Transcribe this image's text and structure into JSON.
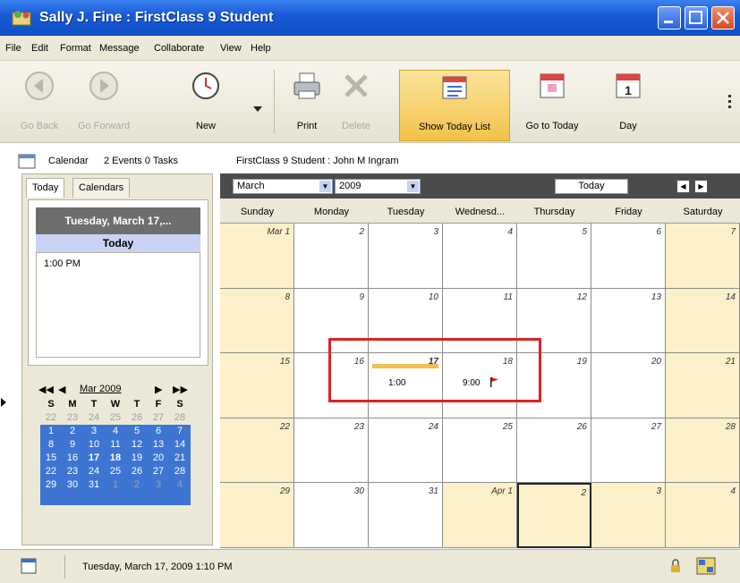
{
  "window": {
    "title": "Sally J. Fine : FirstClass 9 Student"
  },
  "menu": [
    "File",
    "Edit",
    "Format",
    "Message",
    "Collaborate",
    "View",
    "Help"
  ],
  "toolbar": {
    "go_back": "Go Back",
    "go_forward": "Go Forward",
    "new": "New",
    "print": "Print",
    "delete": "Delete",
    "show_today_list": "Show Today List",
    "go_to_today": "Go to Today",
    "day": "Day"
  },
  "infobar": {
    "calendar": "Calendar",
    "counts": "2 Events 0 Tasks",
    "path": "FirstClass 9 Student : John M Ingram"
  },
  "left_panel": {
    "tabs": [
      "Today",
      "Calendars"
    ],
    "date_header": "Tuesday, March 17,...",
    "today_label": "Today",
    "today_items": [
      "1:00 PM"
    ]
  },
  "mini_calendar": {
    "nav_first": "◀◀",
    "nav_prev": "◀",
    "month_label": "Mar 2009",
    "nav_next": "▶",
    "nav_last": "▶▶",
    "weekdays": [
      "S",
      "M",
      "T",
      "W",
      "T",
      "F",
      "S"
    ],
    "weeks": [
      [
        "22",
        "23",
        "24",
        "25",
        "26",
        "27",
        "28"
      ],
      [
        "1",
        "2",
        "3",
        "4",
        "5",
        "6",
        "7"
      ],
      [
        "8",
        "9",
        "10",
        "11",
        "12",
        "13",
        "14"
      ],
      [
        "15",
        "16",
        "17",
        "18",
        "19",
        "20",
        "21"
      ],
      [
        "22",
        "23",
        "24",
        "25",
        "26",
        "27",
        "28"
      ],
      [
        "29",
        "30",
        "31",
        "1",
        "2",
        "3",
        "4"
      ]
    ]
  },
  "calendar": {
    "month": "March",
    "year": "2009",
    "today_button": "Today",
    "days": [
      "Sunday",
      "Monday",
      "Tuesday",
      "Wednesd...",
      "Thursday",
      "Friday",
      "Saturday"
    ],
    "weeks": [
      [
        "Mar 1",
        "2",
        "3",
        "4",
        "5",
        "6",
        "7"
      ],
      [
        "8",
        "9",
        "10",
        "11",
        "12",
        "13",
        "14"
      ],
      [
        "15",
        "16",
        "17",
        "18",
        "19",
        "20",
        "21"
      ],
      [
        "22",
        "23",
        "24",
        "25",
        "26",
        "27",
        "28"
      ],
      [
        "29",
        "30",
        "31",
        "Apr 1",
        "2",
        "3",
        "4"
      ]
    ],
    "events": [
      {
        "day": "17",
        "time": "1:00"
      },
      {
        "day": "18",
        "time": "9:00"
      }
    ]
  },
  "status": {
    "text": "Tuesday, March 17, 2009 1:10 PM"
  },
  "colors": {
    "highlight": "#dd2222",
    "weekend": "#fbf0c9",
    "mini_selection": "#3e75d3"
  }
}
